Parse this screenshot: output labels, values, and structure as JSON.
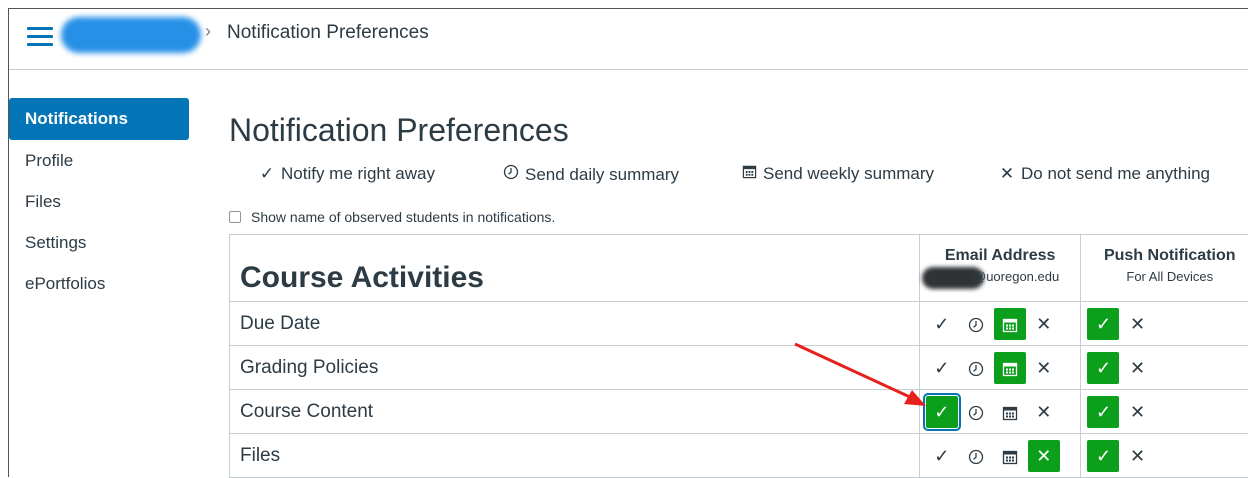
{
  "breadcrumb": {
    "current": "Notification Preferences"
  },
  "sidebar": {
    "items": [
      {
        "label": "Notifications",
        "active": true
      },
      {
        "label": "Profile"
      },
      {
        "label": "Files"
      },
      {
        "label": "Settings"
      },
      {
        "label": "ePortfolios"
      }
    ]
  },
  "main": {
    "title": "Notification Preferences",
    "legend": {
      "right_away": "Notify me right away",
      "daily": "Send daily summary",
      "weekly": "Send weekly summary",
      "never": "Do not send me anything"
    },
    "observed_label": "Show name of observed students in notifications.",
    "table": {
      "section_title": "Course Activities",
      "email_header": "Email Address",
      "email_domain": "@uoregon.edu",
      "push_header": "Push Notification",
      "push_sub": "For All Devices",
      "rows": [
        {
          "label": "Due Date",
          "email": "weekly",
          "push": "right_away"
        },
        {
          "label": "Grading Policies",
          "email": "weekly",
          "push": "right_away"
        },
        {
          "label": "Course Content",
          "email": "right_away",
          "push": "right_away"
        },
        {
          "label": "Files",
          "email": "never",
          "push": "right_away"
        }
      ]
    }
  },
  "colors": {
    "accent": "#0374b5",
    "selected": "#0b9f1b",
    "annotation_arrow": "#e8201c"
  },
  "icons": {
    "right_away": "check-icon",
    "daily": "clock-icon",
    "weekly": "calendar-icon",
    "never": "x-icon"
  }
}
